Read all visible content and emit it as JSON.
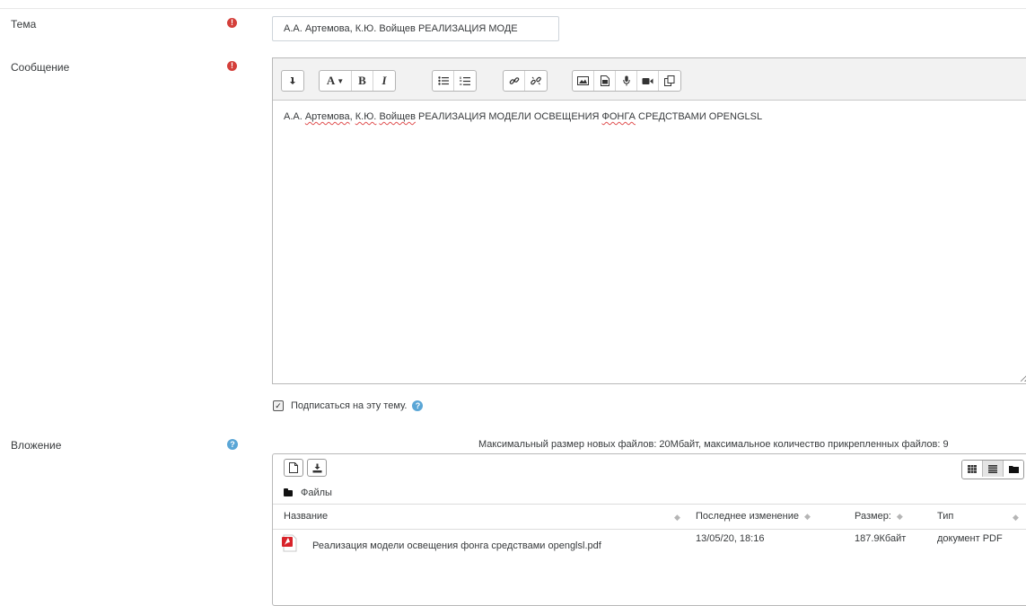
{
  "form": {
    "subject": {
      "label": "Тема",
      "value": "А.А. Артемова, К.Ю. Войщев РЕАЛИЗАЦИЯ МОДЕ"
    },
    "message": {
      "label": "Сообщение",
      "text_parts": [
        "А.А. ",
        "Артемова",
        ", ",
        "К.Ю.",
        " ",
        "Войщев",
        " РЕАЛИЗАЦИЯ МОДЕЛИ ОСВЕЩЕНИЯ ",
        "ФОНГА",
        " СРЕДСТВАМИ OPENGLSL"
      ]
    },
    "subscribe": {
      "label": "Подписаться на эту тему.",
      "checked": true
    },
    "attachment": {
      "label": "Вложение",
      "limits": "Максимальный размер новых файлов: 20Мбайт, максимальное количество прикрепленных файлов: 9",
      "folder": "Файлы",
      "columns": [
        "Название",
        "Последнее изменение",
        "Размер:",
        "Тип"
      ],
      "files": [
        {
          "name": "Реализация модели освещения фонга средствами openglsl.pdf",
          "modified": "13/05/20, 18:16",
          "size": "187.9Кбайт",
          "type": "документ PDF"
        }
      ]
    }
  },
  "editor_toolbar": {
    "font_button": "A",
    "bold": "B",
    "italic": "I"
  },
  "colors": {
    "required": "#d43f3a",
    "help": "#5aa6d6",
    "text": "#373a3c",
    "toolbar_bg": "#f2f2f2"
  }
}
